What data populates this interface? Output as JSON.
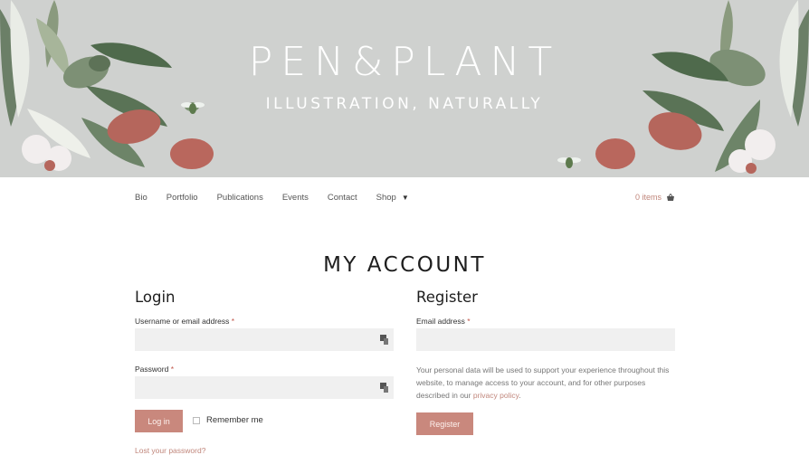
{
  "brand": {
    "title": "PEN&PLANT",
    "tagline": "ILLUSTRATION, NATURALLY"
  },
  "nav": {
    "items": [
      {
        "label": "Bio"
      },
      {
        "label": "Portfolio"
      },
      {
        "label": "Publications"
      },
      {
        "label": "Events"
      },
      {
        "label": "Contact"
      },
      {
        "label": "Shop"
      }
    ],
    "cart_label": "0 items"
  },
  "page_title": "MY ACCOUNT",
  "login": {
    "heading": "Login",
    "username_label": "Username or email address",
    "required_mark": "*",
    "password_label": "Password",
    "button_label": "Log in",
    "remember_label": "Remember me",
    "lost_password": "Lost your password?"
  },
  "register": {
    "heading": "Register",
    "email_label": "Email address",
    "required_mark": "*",
    "privacy_text": "Your personal data will be used to support your experience throughout this website, to manage access to your account, and for other purposes described in our",
    "privacy_link": "privacy policy",
    "privacy_end": ".",
    "button_label": "Register"
  },
  "colors": {
    "banner": "#cfd1cf",
    "accent": "#c9887d",
    "link": "#c0867b",
    "input_bg": "#f0f0f0"
  },
  "icons": [
    "chevron-down-icon",
    "basket-icon",
    "key-icon",
    "checkbox-icon"
  ]
}
